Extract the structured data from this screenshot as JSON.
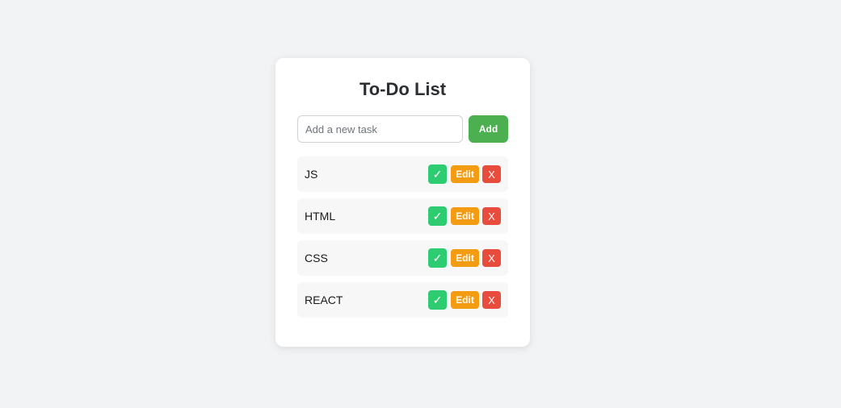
{
  "app": {
    "title": "To-Do List"
  },
  "input": {
    "value": "",
    "placeholder": "Add a new task",
    "add_label": "Add"
  },
  "actions": {
    "done_label": "✓",
    "edit_label": "Edit",
    "delete_label": "X"
  },
  "tasks": [
    {
      "label": "JS"
    },
    {
      "label": "HTML"
    },
    {
      "label": "CSS"
    },
    {
      "label": "REACT"
    }
  ],
  "colors": {
    "background": "#f2f3f5",
    "card": "#ffffff",
    "add_button": "#4caf50",
    "done_button": "#2ecc71",
    "edit_button": "#f39c12",
    "delete_button": "#e74c3c",
    "task_row": "#f7f7f7"
  }
}
